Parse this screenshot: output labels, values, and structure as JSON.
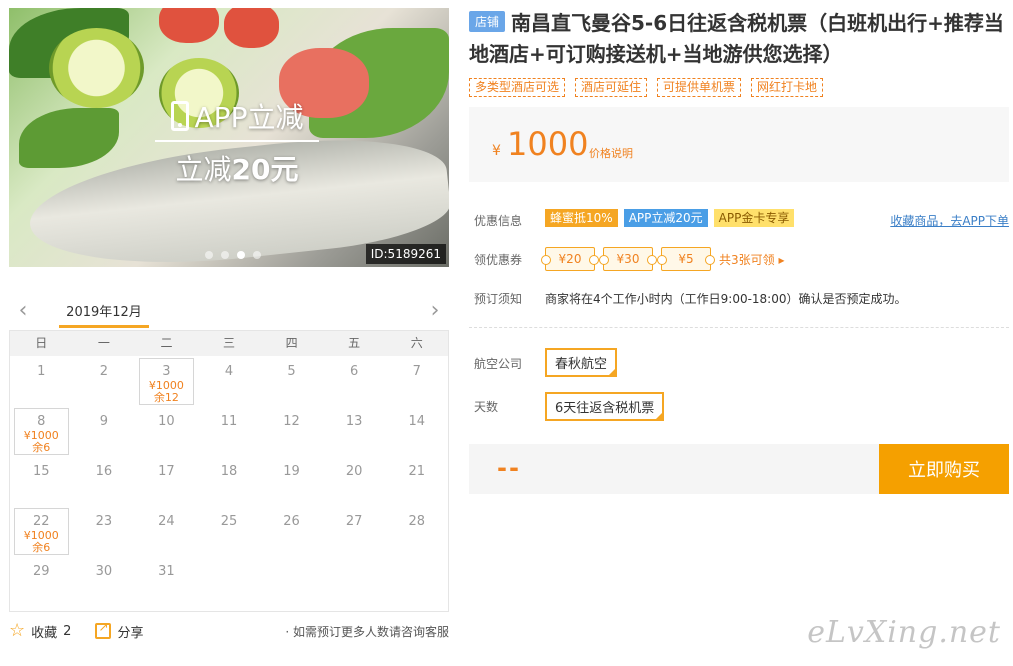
{
  "hero": {
    "promo_app": "APP立减",
    "promo_prefix": "立减",
    "promo_amount": "20元",
    "image_id": "ID:5189261",
    "dot_count": 4,
    "active_dot": 3
  },
  "calendar": {
    "month": "2019年12月",
    "weekdays": [
      "日",
      "一",
      "二",
      "三",
      "四",
      "五",
      "六"
    ],
    "weeks": [
      [
        {
          "d": "1"
        },
        {
          "d": "2"
        },
        {
          "d": "3",
          "price": "¥1000",
          "remain": "余12"
        },
        {
          "d": "4"
        },
        {
          "d": "5"
        },
        {
          "d": "6"
        },
        {
          "d": "7"
        }
      ],
      [
        {
          "d": "8",
          "price": "¥1000",
          "remain": "余6"
        },
        {
          "d": "9"
        },
        {
          "d": "10"
        },
        {
          "d": "11"
        },
        {
          "d": "12"
        },
        {
          "d": "13"
        },
        {
          "d": "14"
        }
      ],
      [
        {
          "d": "15"
        },
        {
          "d": "16"
        },
        {
          "d": "17"
        },
        {
          "d": "18"
        },
        {
          "d": "19"
        },
        {
          "d": "20"
        },
        {
          "d": "21"
        }
      ],
      [
        {
          "d": "22",
          "price": "¥1000",
          "remain": "余6"
        },
        {
          "d": "23"
        },
        {
          "d": "24"
        },
        {
          "d": "25"
        },
        {
          "d": "26"
        },
        {
          "d": "27"
        },
        {
          "d": "28"
        }
      ],
      [
        {
          "d": "29"
        },
        {
          "d": "30"
        },
        {
          "d": "31"
        },
        {
          "d": ""
        },
        {
          "d": ""
        },
        {
          "d": ""
        },
        {
          "d": ""
        }
      ]
    ]
  },
  "footer": {
    "favorite_label": "收藏",
    "favorite_count": "2",
    "share_label": "分享",
    "consult_text": "· 如需预订更多人数请咨询客服"
  },
  "product": {
    "shop_tag": "店铺",
    "title": "南昌直飞曼谷5-6日往返含税机票（白班机出行+推荐当地酒店+可订购接送机+当地游供您选择）",
    "feature_tags": [
      "多类型酒店可选",
      "酒店可延住",
      "可提供单机票",
      "网红打卡地"
    ],
    "price_symbol": "¥",
    "price": "1000",
    "price_note": "价格说明"
  },
  "info": {
    "discount_label": "优惠信息",
    "badges": [
      {
        "text": "蜂蜜抵10%",
        "style": "orange"
      },
      {
        "text": "APP立减20元",
        "style": "blue"
      },
      {
        "text": "APP金卡专享",
        "style": "gold"
      }
    ],
    "app_link": "收藏商品，去APP下单",
    "coupon_label": "领优惠券",
    "coupons": [
      "¥20",
      "¥30",
      "¥5"
    ],
    "coupon_more": "共3张可领 ▸",
    "notice_label": "预订须知",
    "notice_text": "商家将在4个工作小时内（工作日9:00-18:00）确认是否预定成功。"
  },
  "options": {
    "airline_label": "航空公司",
    "airline_value": "春秋航空",
    "days_label": "天数",
    "days_value": "6天往返含税机票"
  },
  "buy": {
    "total": "--",
    "button": "立即购买"
  },
  "watermark": "eLvXing.net",
  "colors": {
    "accent": "#f08220",
    "buy_button": "#f5a000",
    "shop_tag": "#6aa6e8",
    "badge_blue": "#4a9ee6"
  }
}
